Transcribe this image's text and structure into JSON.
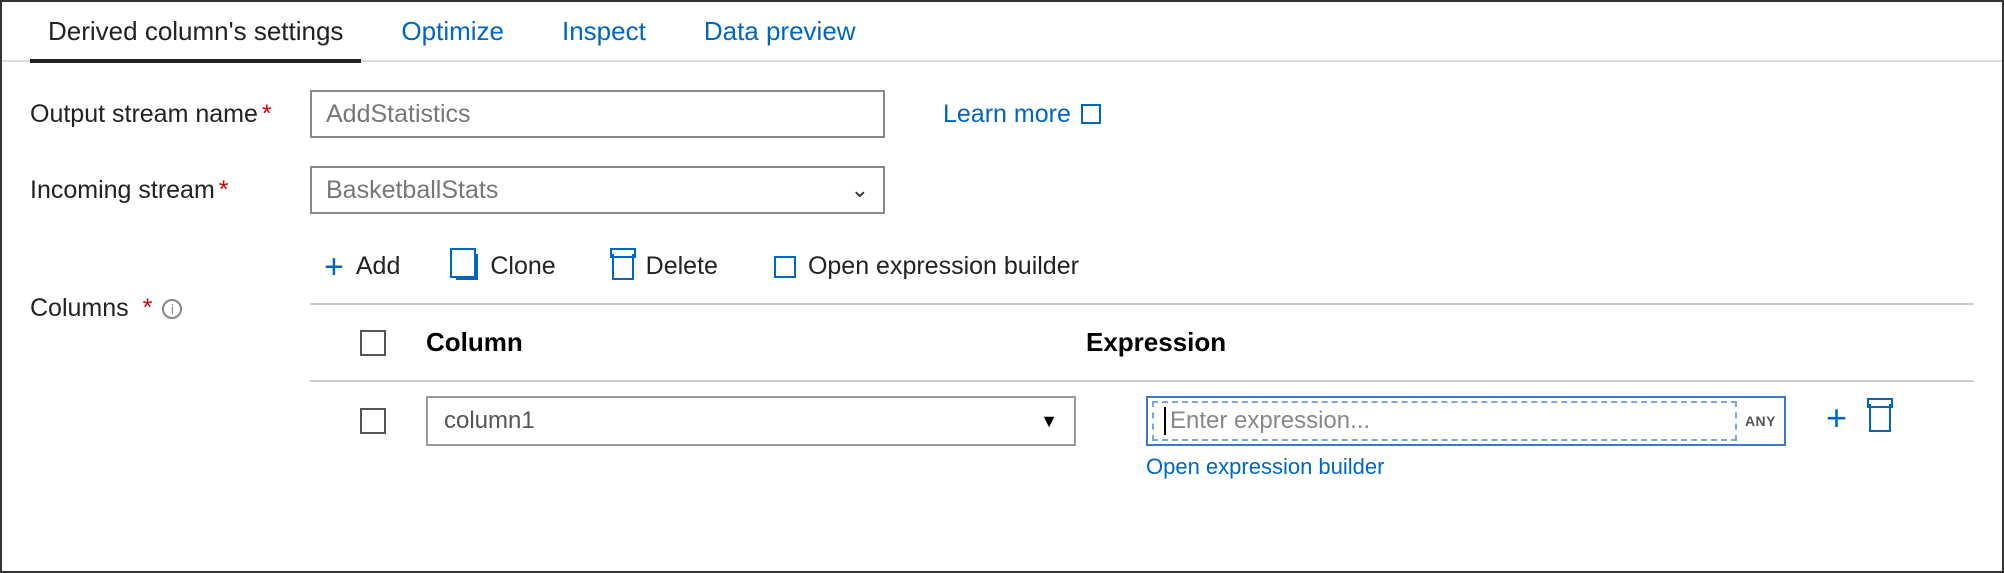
{
  "tabs": {
    "settings": "Derived column's settings",
    "optimize": "Optimize",
    "inspect": "Inspect",
    "preview": "Data preview"
  },
  "labels": {
    "output_stream": "Output stream name",
    "incoming_stream": "Incoming stream",
    "columns": "Columns"
  },
  "fields": {
    "output_stream_value": "AddStatistics",
    "incoming_stream_value": "BasketballStats"
  },
  "links": {
    "learn_more": "Learn more",
    "open_expr_builder_row": "Open expression builder"
  },
  "toolbar": {
    "add": "Add",
    "clone": "Clone",
    "delete": "Delete",
    "open_builder": "Open expression builder"
  },
  "table": {
    "header_column": "Column",
    "header_expression": "Expression",
    "rows": [
      {
        "column": "column1",
        "expression_placeholder": "Enter expression...",
        "type_badge": "ANY"
      }
    ]
  }
}
